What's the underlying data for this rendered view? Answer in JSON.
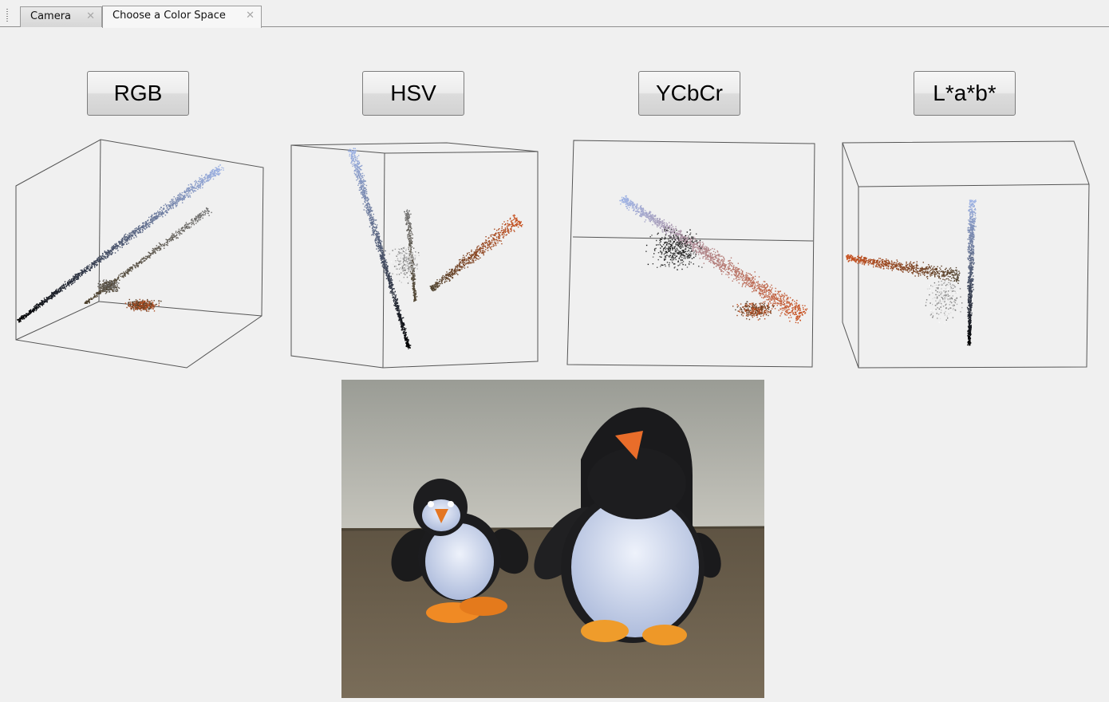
{
  "tabs": [
    {
      "label": "Camera",
      "active": false
    },
    {
      "label": "Choose a Color Space",
      "active": true
    }
  ],
  "close_glyph": "✕",
  "color_spaces": [
    {
      "label": "RGB"
    },
    {
      "label": "HSV"
    },
    {
      "label": "YCbCr"
    },
    {
      "label": "L*a*b*"
    }
  ],
  "colors": {
    "background": "#f0f0f0",
    "point_blue": "#9fb4e6",
    "point_gray": "#707070",
    "point_brown": "#4a3e2a",
    "point_orange": "#c8501e",
    "point_black": "#000000"
  }
}
